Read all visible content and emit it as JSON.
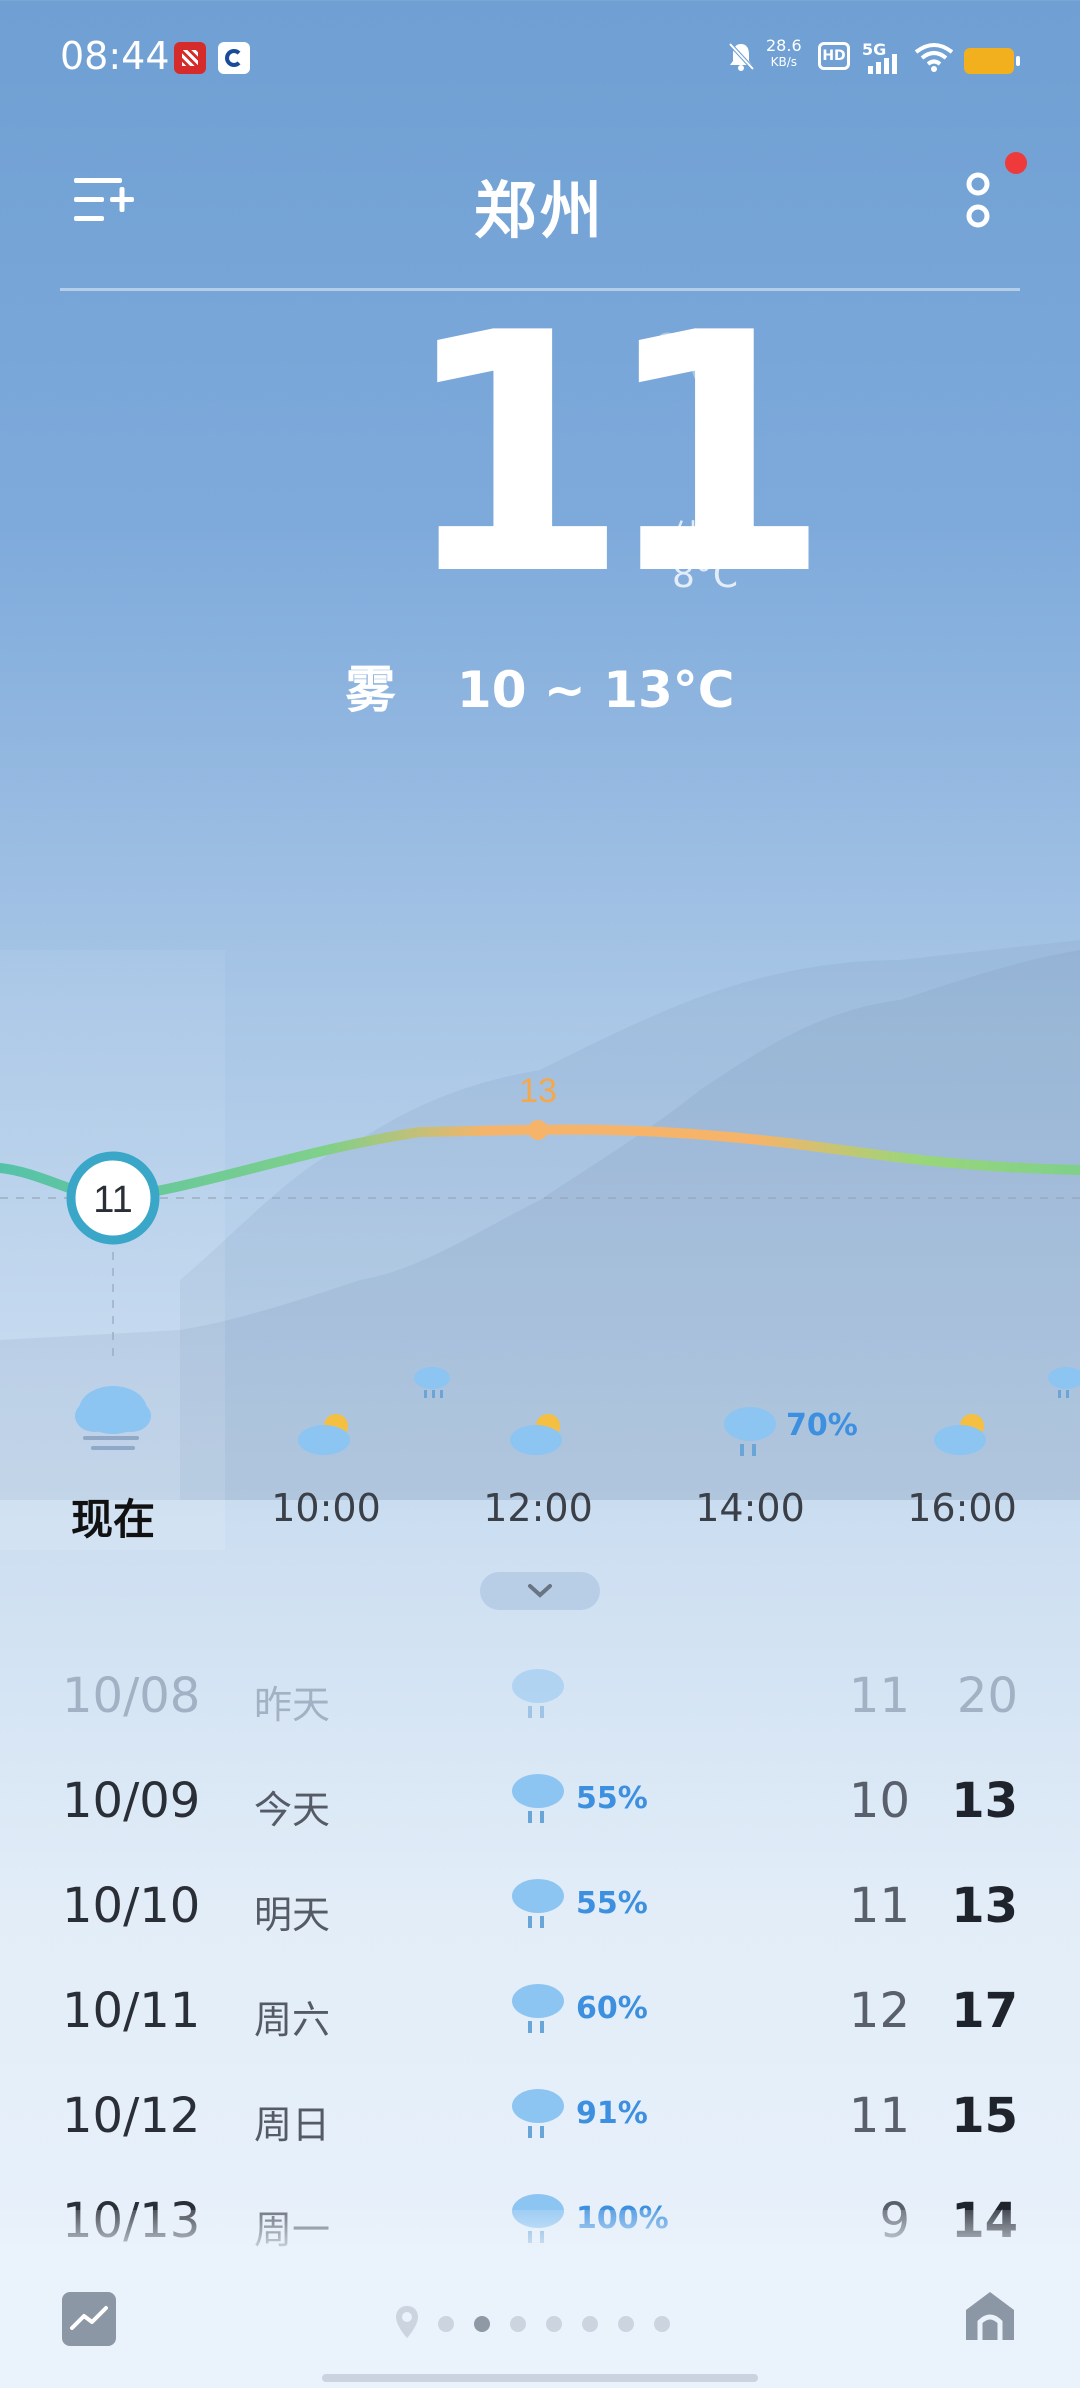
{
  "status_bar": {
    "time": "08:44",
    "net_speed_value": "28.6",
    "net_speed_unit": "KB/s",
    "hd_label": "HD",
    "network_label": "5G",
    "battery_color": "#f2b01e"
  },
  "header": {
    "city": "郑州",
    "menu_icon": "add-city-list-icon",
    "more_icon": "more-dots-icon",
    "notification_dot_color": "#ee3a3a"
  },
  "current": {
    "temperature": "11",
    "unit": "°C",
    "feels_like_label": "体感",
    "feels_like_value": "8°C",
    "condition": "雾",
    "range": "10 ~ 13°C"
  },
  "hourly_chart": {
    "current_marker": "11",
    "peak_label": "13",
    "line_colors": [
      "#55c2a8",
      "#f5b46a"
    ]
  },
  "hourly": [
    {
      "label": "现在",
      "icon": "fog-cloud-icon",
      "precip": ""
    },
    {
      "label": "10:00",
      "icon": "partly-cloudy-icon",
      "precip": ""
    },
    {
      "label": "12:00",
      "icon": "partly-cloudy-icon",
      "precip": ""
    },
    {
      "label": "14:00",
      "icon": "rain-cloud-icon",
      "precip": "70%"
    },
    {
      "label": "16:00",
      "icon": "partly-cloudy-icon",
      "precip": ""
    }
  ],
  "daily": [
    {
      "date": "10/08",
      "day": "昨天",
      "icon": "rain-cloud-icon",
      "prob": "",
      "low": "11",
      "high": "20"
    },
    {
      "date": "10/09",
      "day": "今天",
      "icon": "rain-cloud-icon",
      "prob": "55%",
      "low": "10",
      "high": "13"
    },
    {
      "date": "10/10",
      "day": "明天",
      "icon": "rain-cloud-icon",
      "prob": "55%",
      "low": "11",
      "high": "13"
    },
    {
      "date": "10/11",
      "day": "周六",
      "icon": "rain-cloud-icon",
      "prob": "60%",
      "low": "12",
      "high": "17"
    },
    {
      "date": "10/12",
      "day": "周日",
      "icon": "rain-cloud-icon",
      "prob": "91%",
      "low": "11",
      "high": "15"
    },
    {
      "date": "10/13",
      "day": "周一",
      "icon": "rain-cloud-icon",
      "prob": "100%",
      "low": "9",
      "high": "14"
    }
  ],
  "bottom": {
    "trend_icon": "trend-chart-icon",
    "home_icon": "home-icon",
    "location_icon": "location-pin-icon",
    "page_count": 7,
    "active_page": 2
  }
}
